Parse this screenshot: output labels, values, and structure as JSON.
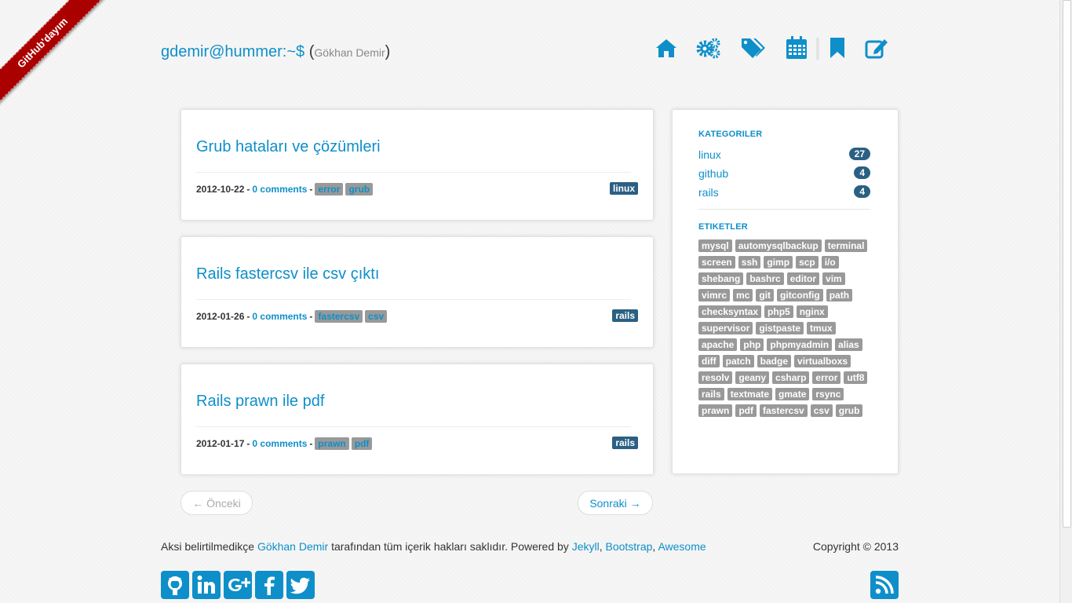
{
  "ribbon": {
    "text": "GitHub'dayım"
  },
  "header": {
    "brand": "gdemir@hummer:~$",
    "open_paren": "(",
    "subtitle": "Gökhan Demir",
    "close_paren": ")",
    "nav_icons": [
      "home-icon",
      "gears-icon",
      "tags-icon",
      "calendar-icon",
      "bookmark-icon",
      "edit-icon"
    ]
  },
  "posts": [
    {
      "title": "Grub hataları ve çözümleri",
      "date": "2012-10-22",
      "sep1": "-",
      "comments": "0 comments",
      "sep2": "-",
      "tags": [
        "error",
        "grub"
      ],
      "category": "linux"
    },
    {
      "title": "Rails fastercsv ile csv çıktı",
      "date": "2012-01-26",
      "sep1": "-",
      "comments": "0 comments",
      "sep2": "-",
      "tags": [
        "fastercsv",
        "csv"
      ],
      "category": "rails"
    },
    {
      "title": "Rails prawn ile pdf",
      "date": "2012-01-17",
      "sep1": "-",
      "comments": "0 comments",
      "sep2": "-",
      "tags": [
        "prawn",
        "pdf"
      ],
      "category": "rails"
    }
  ],
  "sidebar": {
    "categories_title": "KATEGORILER",
    "categories": [
      {
        "name": "linux",
        "count": "27"
      },
      {
        "name": "github",
        "count": "4"
      },
      {
        "name": "rails",
        "count": "4"
      }
    ],
    "tags_title": "ETIKETLER",
    "tags": [
      "mysql",
      "automysqlbackup",
      "terminal",
      "screen",
      "ssh",
      "gimp",
      "scp",
      "i/o",
      "shebang",
      "bashrc",
      "editor",
      "vim",
      "vimrc",
      "mc",
      "git",
      "gitconfig",
      "path",
      "checksyntax",
      "php5",
      "nginx",
      "supervisor",
      "gistpaste",
      "tmux",
      "apache",
      "php",
      "phpmyadmin",
      "alias",
      "diff",
      "patch",
      "badge",
      "virtualboxs",
      "resolv",
      "geany",
      "csharp",
      "error",
      "utf8",
      "rails",
      "textmate",
      "gmate",
      "rsync",
      "prawn",
      "pdf",
      "fastercsv",
      "csv",
      "grub"
    ]
  },
  "pager": {
    "prev": "← Önceki",
    "next": "Sonraki →"
  },
  "footer": {
    "text1": "Aksi belirtilmedikçe ",
    "author": "Gökhan Demir",
    "text2": " tarafından tüm içerik hakları saklıdır. Powered by ",
    "link1": "Jekyll",
    "comma1": ", ",
    "link2": "Bootstrap",
    "comma2": ", ",
    "link3": "Awesome",
    "copyright": "Copyright © 2013",
    "social_icons": [
      "github-icon",
      "linkedin-icon",
      "google-plus-icon",
      "facebook-icon",
      "twitter-icon"
    ],
    "rss_icon": "rss-icon"
  },
  "colors": {
    "accent": "#0e8fc9",
    "ribbon": "#aa0000",
    "tag": "#999999",
    "badge": "#2a6083"
  }
}
